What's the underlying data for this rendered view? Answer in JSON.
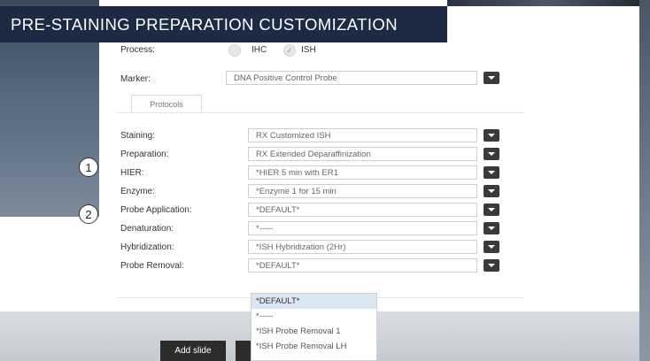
{
  "title": "PRE-STAINING PREPARATION CUSTOMIZATION",
  "process": {
    "label": "Process:",
    "options": [
      {
        "label": "IHC",
        "checked": false
      },
      {
        "label": "ISH",
        "checked": true
      }
    ]
  },
  "marker": {
    "label": "Marker:",
    "value": "DNA Positive Control Probe"
  },
  "protocols_tab": "Protocols",
  "rows": [
    {
      "label": "Staining:",
      "value": "RX Customized ISH"
    },
    {
      "label": "Preparation:",
      "value": "RX Extended Deparaffinization"
    },
    {
      "label": "HIER:",
      "value": "*HIER 5 min with ER1"
    },
    {
      "label": "Enzyme:",
      "value": "*Enzyme 1 for 15 min"
    },
    {
      "label": "Probe Application:",
      "value": "*DEFAULT*"
    },
    {
      "label": "Denaturation:",
      "value": "*-----"
    },
    {
      "label": "Hybridization:",
      "value": "*ISH Hybridization (2Hr)"
    },
    {
      "label": "Probe Removal:",
      "value": "*DEFAULT*"
    }
  ],
  "callouts": [
    "1",
    "2"
  ],
  "dropdown_options": [
    "*DEFAULT*",
    "*-----",
    "*ISH Probe Removal 1",
    "*ISH Probe Removal LH"
  ],
  "add_slide": "Add slide",
  "colors": {
    "title_bg": "#1d2a44",
    "button_dark": "#2c2c2c",
    "selected_option": "#dbe6f3"
  }
}
